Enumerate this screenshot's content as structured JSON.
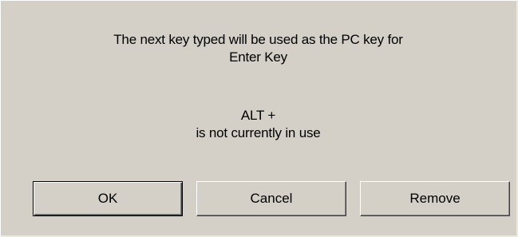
{
  "dialog": {
    "message_line1": "The next key typed will be used as the PC key for",
    "message_line2": "Enter Key",
    "status_line1": "ALT +",
    "status_line2": "is not currently in use"
  },
  "buttons": {
    "ok_label": "OK",
    "cancel_label": "Cancel",
    "remove_label": "Remove"
  },
  "colors": {
    "dialog_background": "#d4d0c8",
    "text": "#000000"
  }
}
